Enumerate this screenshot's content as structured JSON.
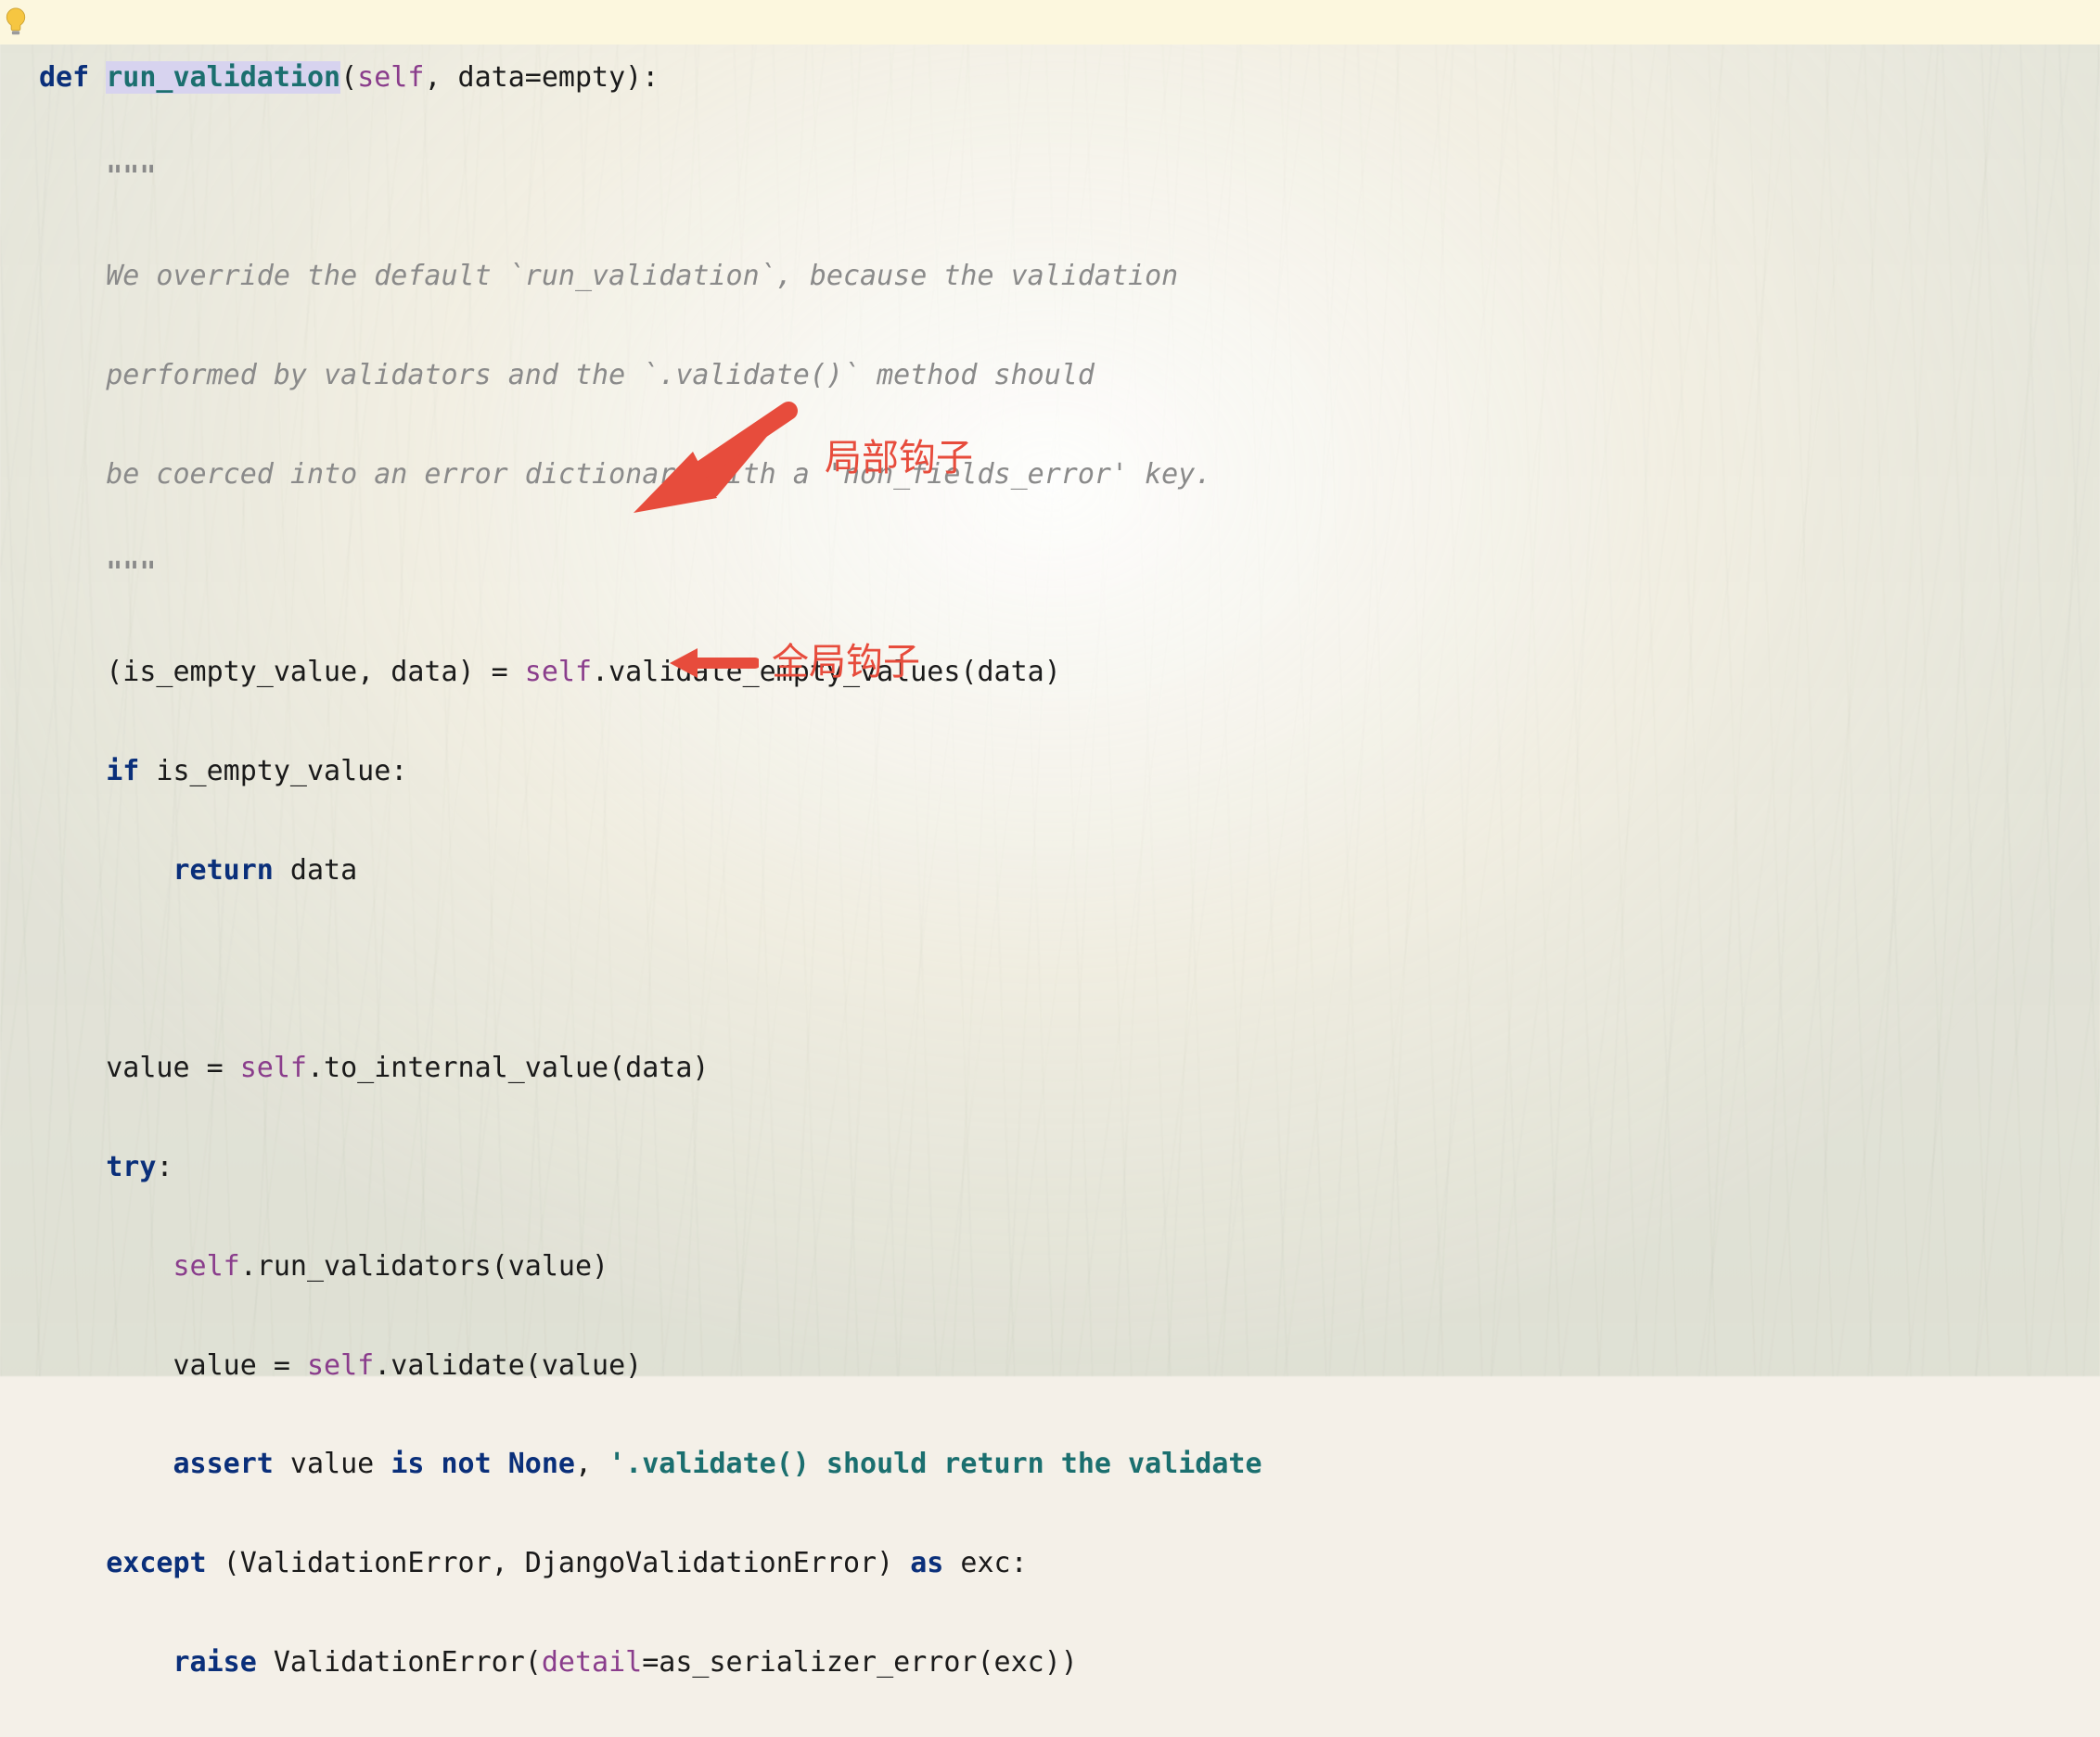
{
  "gutter": {
    "lightbulb_icon": "lightbulb-icon"
  },
  "code": {
    "def_kw": "def",
    "fn_name": "run_validation",
    "sig_open": "(",
    "self_kw": "self",
    "sig_rest": ", data=empty):",
    "doc_q1": "\"\"\"",
    "doc_l1": "We override the default `run_validation`, because the validation",
    "doc_l2": "performed by validators and the `.validate()` method should",
    "doc_l3": "be coerced into an error dictionary with a 'non_fields_error' key.",
    "doc_q2": "\"\"\"",
    "l_pre_assign": "(is_empty_value, data) = ",
    "l_self1": "self",
    "l_call1": ".validate_empty_values(data)",
    "if_kw": "if",
    "if_cond": " is_empty_value:",
    "return_kw": "return",
    "return_val": " data",
    "l_value_eq": "value = ",
    "l_self2": "self",
    "l_to_internal": ".to_internal_value(data)",
    "try_kw": "try",
    "try_colon": ":",
    "l_self3": "self",
    "l_run_validators": ".run_validators(value)",
    "l_value_eq2": "value = ",
    "l_self4": "self",
    "l_validate": ".validate(value)",
    "assert_kw": "assert",
    "assert_val": " value ",
    "is_not_none": "is not None",
    "assert_comma": ", ",
    "assert_str": "'.validate() should return the validate",
    "except_kw": "except",
    "except_mid": " (ValidationError, DjangoValidationError) ",
    "as_kw": "as",
    "except_tail": " exc:",
    "raise_kw": "raise",
    "raise_mid": " ValidationError(",
    "detail_kw": "detail",
    "raise_tail": "=as_serializer_error(exc))"
  },
  "annotations": {
    "local_hook": "局部钩子",
    "global_hook": "全局钩子"
  }
}
